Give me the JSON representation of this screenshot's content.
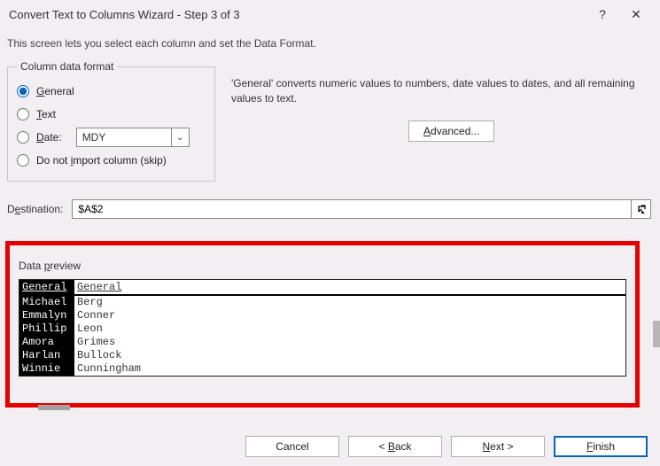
{
  "titlebar": {
    "title": "Convert Text to Columns Wizard - Step 3 of 3"
  },
  "subtitle": "This screen lets you select each column and set the Data Format.",
  "format_group": {
    "legend": "Column data format",
    "general": "General",
    "text": "Text",
    "date": "Date:",
    "date_order": "MDY",
    "skip": "Do not import column (skip)"
  },
  "help_text": "'General' converts numeric values to numbers, date values to dates, and all remaining values to text.",
  "advanced_label": "Advanced...",
  "destination": {
    "label": "Destination:",
    "value": "$A$2"
  },
  "preview": {
    "label": "Data preview",
    "headers": [
      "General",
      "General"
    ],
    "rows": [
      [
        "Michael",
        "Berg"
      ],
      [
        "Emmalyn",
        "Conner"
      ],
      [
        "Phillip",
        "Leon"
      ],
      [
        "Amora",
        "Grimes"
      ],
      [
        "Harlan",
        "Bullock"
      ],
      [
        "Winnie",
        "Cunningham"
      ]
    ]
  },
  "buttons": {
    "cancel": "Cancel",
    "back": "< Back",
    "next": "Next >",
    "finish": "Finish"
  }
}
